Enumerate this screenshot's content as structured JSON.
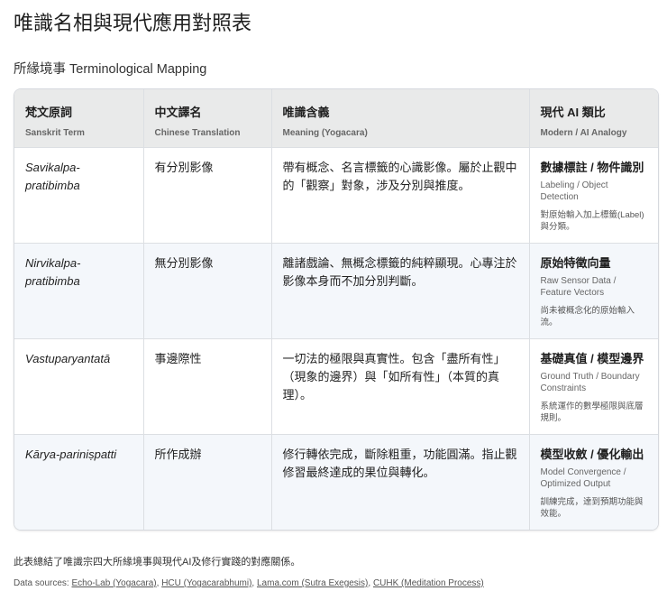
{
  "title": "唯識名相與現代應用對照表",
  "subtitle": "所緣境事 Terminological Mapping",
  "table": {
    "headers": [
      {
        "main": "梵文原詞",
        "sub": "Sanskrit Term"
      },
      {
        "main": "中文譯名",
        "sub": "Chinese Translation"
      },
      {
        "main": "唯識含義",
        "sub": "Meaning (Yogacara)"
      },
      {
        "main": "現代 AI 類比",
        "sub": "Modern / AI Analogy"
      }
    ],
    "rows": [
      {
        "term": "Savikalpa-pratibimba",
        "zh": "有分別影像",
        "meaning": "帶有概念、名言標籤的心識影像。屬於止觀中的「觀察」對象，涉及分別與推度。",
        "ai_main": "數據標註 / 物件識別",
        "ai_sub": "Labeling / Object Detection",
        "ai_note": "對原始輸入加上標籤(Label)與分類。"
      },
      {
        "term": "Nirvikalpa-pratibimba",
        "zh": "無分別影像",
        "meaning": "離諸戲論、無概念標籤的純粹顯現。心專注於影像本身而不加分別判斷。",
        "ai_main": "原始特徵向量",
        "ai_sub": "Raw Sensor Data / Feature Vectors",
        "ai_note": "尚未被概念化的原始輸入流。"
      },
      {
        "term": "Vastuparyantatā",
        "zh": "事邊際性",
        "meaning": "一切法的極限與真實性。包含「盡所有性」（現象的邊界）與「如所有性」（本質的真理）。",
        "ai_main": "基礎真值 / 模型邊界",
        "ai_sub": "Ground Truth / Boundary Constraints",
        "ai_note": "系統運作的數學極限與底層規則。"
      },
      {
        "term": "Kārya-pariniṣpatti",
        "zh": "所作成辦",
        "meaning": "修行轉依完成，斷除粗重，功能圓滿。指止觀修習最終達成的果位與轉化。",
        "ai_main": "模型收斂 / 優化輸出",
        "ai_sub": "Model Convergence / Optimized Output",
        "ai_note": "訓練完成，達到預期功能與效能。"
      }
    ]
  },
  "summary": "此表總結了唯識宗四大所緣境事與現代AI及修行實踐的對應關係。",
  "sources": {
    "label": "Data sources:",
    "links": [
      "Echo-Lab (Yogacara)",
      "HCU (Yogacarabhumi)",
      "Lama.com (Sutra Exegesis)",
      "CUHK (Meditation Process)"
    ]
  }
}
